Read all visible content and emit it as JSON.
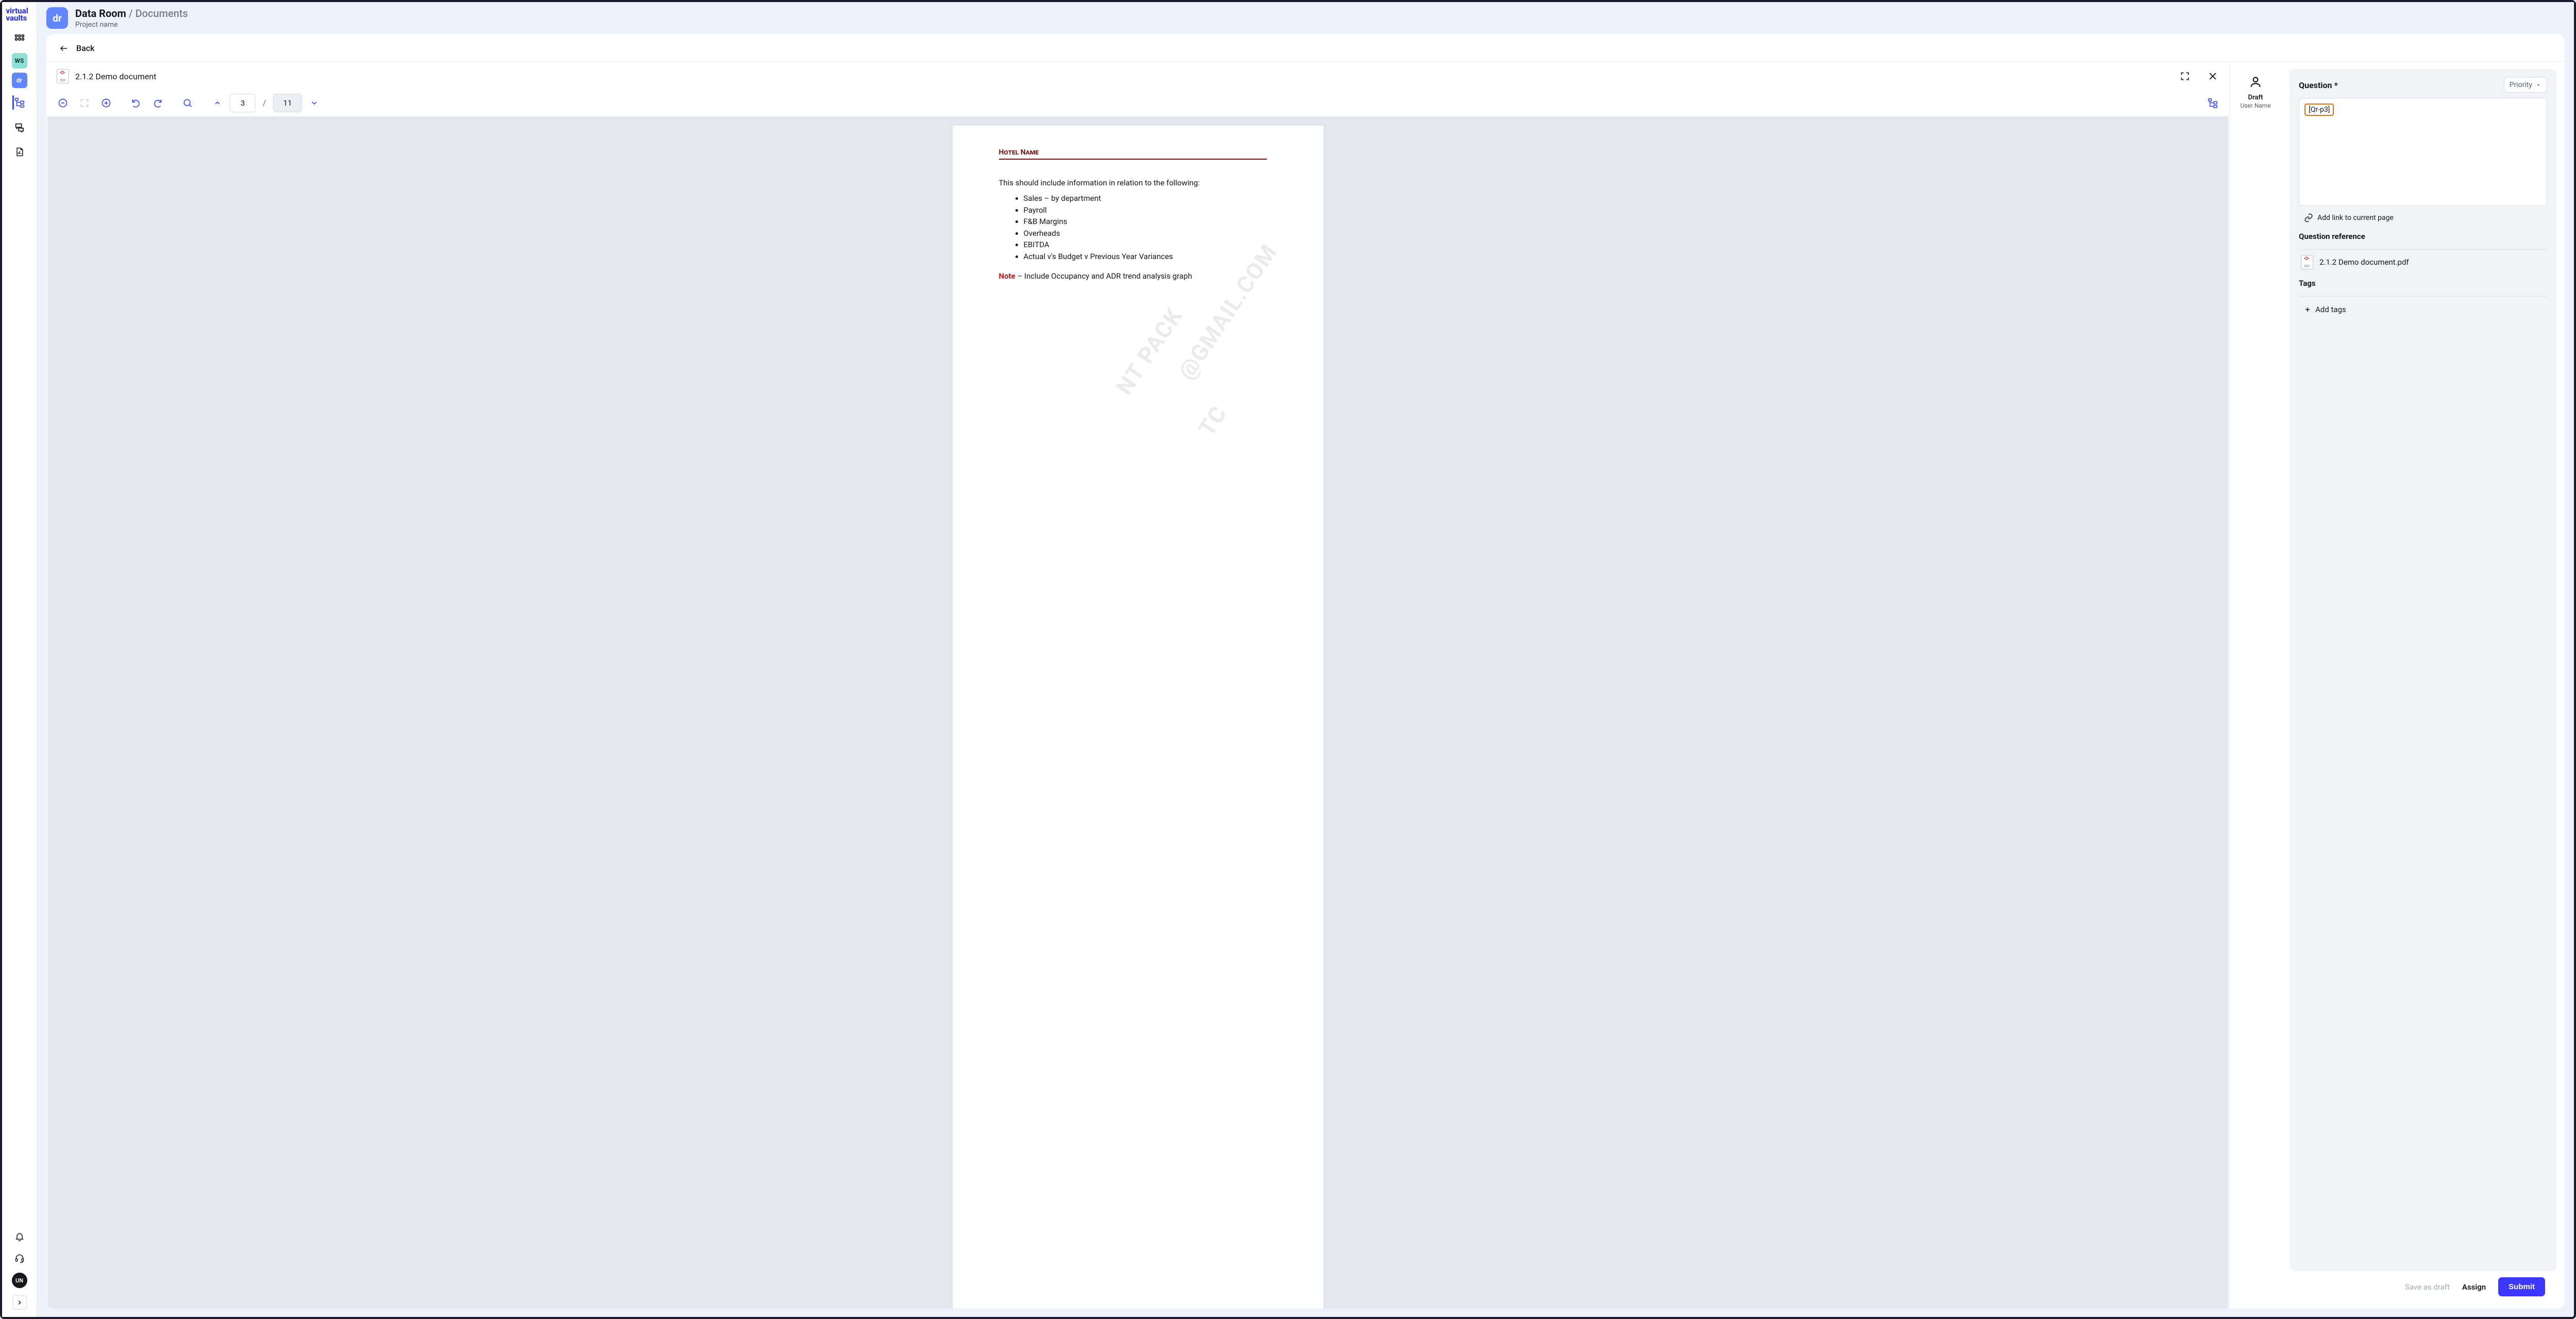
{
  "brand": {
    "line1": "virtual",
    "line2": "vaults"
  },
  "rail": {
    "ws_badge": "WS",
    "dr_badge": "dr",
    "avatar": "UN"
  },
  "header": {
    "proj_badge": "dr",
    "crumb_main": "Data Room",
    "crumb_sep": " / ",
    "crumb_sub": "Documents",
    "project": "Project name"
  },
  "back_label": "Back",
  "doc": {
    "title": "2.1.2 Demo document",
    "pdf_label": "PDF",
    "page_current": "3",
    "page_total": "11",
    "slash": "/",
    "content": {
      "heading": "Hotel Name",
      "intro": "This should include information in relation to the following:",
      "bullets": [
        "Sales – by department",
        "Payroll",
        "F&B Margins",
        "Overheads",
        "EBITDA",
        "Actual v's Budget v Previous Year Variances"
      ],
      "note_label": "Note",
      "note_text": " – Include Occupancy and ADR trend analysis graph",
      "watermark_a": "NT PACK",
      "watermark_b": "@GMAIL.COM",
      "watermark_c": "TC"
    }
  },
  "user": {
    "status": "Draft",
    "name": "User Name"
  },
  "question": {
    "label": "Question *",
    "priority_label": "Priority",
    "chip": "[Qr-p3]",
    "add_link": "Add link to current page",
    "ref_heading": "Question reference",
    "ref_file": "2.1.2 Demo document.pdf",
    "tags_heading": "Tags",
    "add_tags": "Add tags"
  },
  "footer": {
    "save_draft": "Save as draft",
    "assign": "Assign",
    "submit": "Submit"
  }
}
